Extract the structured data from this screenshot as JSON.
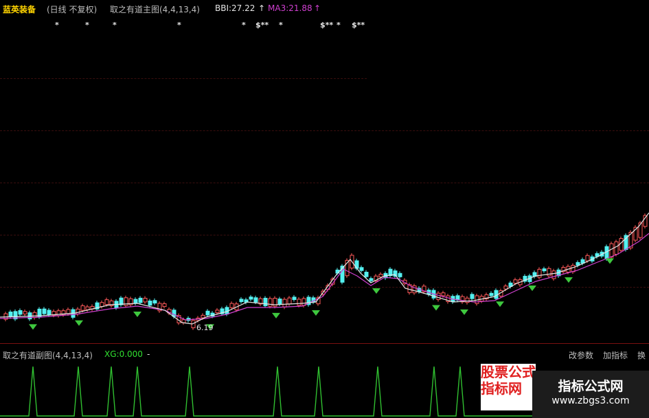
{
  "header": {
    "stock_name": "蓝英装备",
    "period": "(日线 不复权)",
    "indicator_title": "取之有道主图(4,4,13,4)",
    "bbi_label": "BBI:27.22",
    "bbi_arrow": "↑",
    "ma3_label": "MA3:21.88",
    "ma3_arrow": "↑"
  },
  "signal_marks": [
    "*",
    "*",
    "*",
    "*",
    "*",
    "$**",
    "*",
    "$**",
    "*",
    "$**"
  ],
  "price_low_label": "6.19",
  "sub_panel": {
    "title": "取之有道副图(4,4,13,4)",
    "xg_label": "XG:0.000",
    "dash": "-",
    "menu": [
      "改参数",
      "加指标",
      "换"
    ]
  },
  "watermark": {
    "left_text": "股票公式指标网",
    "title": "指标公式网",
    "url": "www.zbgs3.com"
  },
  "colors": {
    "bbi": "#e6e6e6",
    "ma3": "#d040d0",
    "up_candle": "#ff5a5a",
    "down_candle": "#54f0f0",
    "sell_marker": "#3ec83e",
    "signal_line": "#30c030",
    "xg": "#30e030"
  },
  "icons": [
    "up-arrow-icon",
    "green-down-triangle-icon"
  ]
}
